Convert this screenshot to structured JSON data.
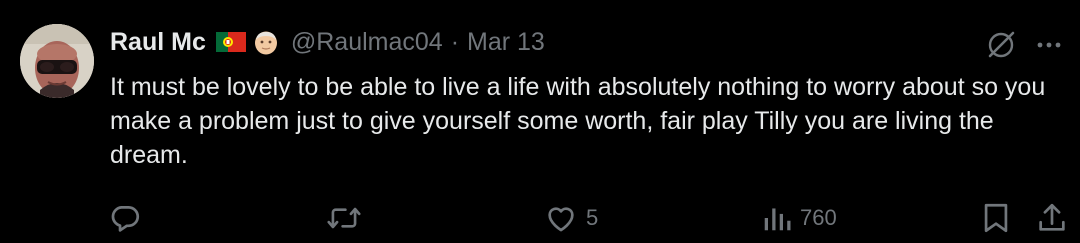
{
  "tweet": {
    "author": {
      "display_name": "Raul Mc",
      "handle": "@Raulmac04",
      "date": "Mar 13",
      "separator": "·"
    },
    "icons": {
      "flag": "portugal-flag-icon",
      "emoji": "older-man-emoji-icon",
      "grok": "grok-icon",
      "more": "more-options-icon"
    },
    "text": "It must be lovely to be able to live a life with absolutely nothing to worry about so you make a problem just to give yourself some worth, fair play Tilly you are living the dream.",
    "actions": {
      "reply_count": "",
      "retweet_count": "",
      "like_count": "5",
      "view_count": "760"
    },
    "colors": {
      "background": "#000000",
      "text_primary": "#e7e9ea",
      "text_secondary": "#71767b"
    }
  }
}
